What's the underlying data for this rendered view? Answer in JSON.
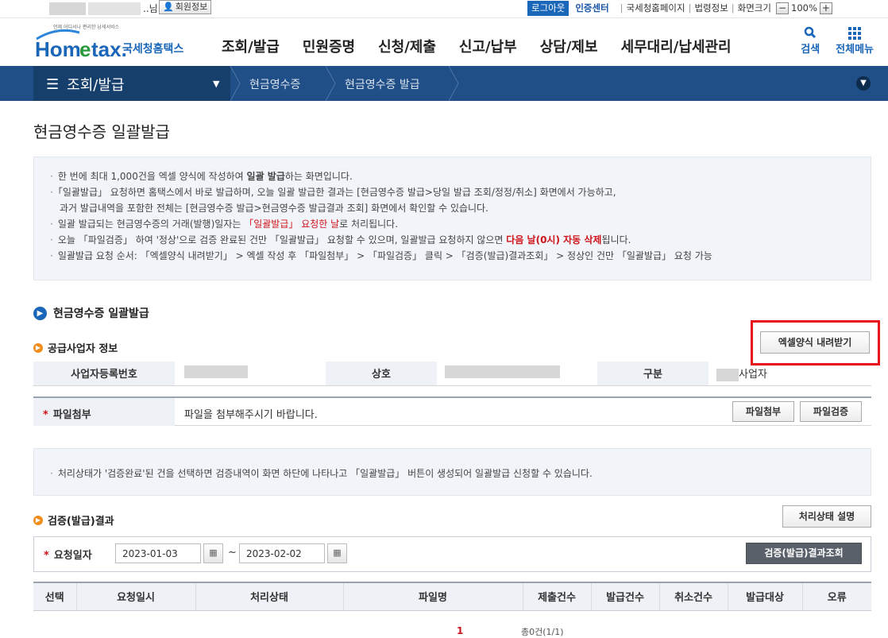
{
  "util": {
    "user_suffix": "..님",
    "profile": "회원정보",
    "logout": "로그아웃",
    "cert_center": "인증센터",
    "links": [
      "국세청홈페이지",
      "법령정보",
      "화면크기"
    ],
    "zoom": "100%"
  },
  "header": {
    "logo_small": "언제 어디서나 편리한 납세서비스",
    "logo_main": "Hometax",
    "logo_kor": "국세청홈택스",
    "gnb": [
      "조회/발급",
      "민원증명",
      "신청/제출",
      "신고/납부",
      "상담/제보",
      "세무대리/납세관리"
    ],
    "search": "검색",
    "all_menu": "전체메뉴"
  },
  "location": {
    "menu": "조회/발급",
    "crumb1": "현금영수증",
    "crumb2": "현금영수증 발급"
  },
  "page_title": "현금영수증 일괄발급",
  "info": {
    "l1a": "한 번에 최대 1,000건을 엑셀 양식에 작성하여 ",
    "l1b": "일괄 발급",
    "l1c": "하는 화면입니다.",
    "l2": "「일괄발급」 요청하면 홈택스에서 바로 발급하며, 오늘 일괄 발급한 결과는 [현금영수증 발급>당일 발급 조회/정정/취소] 화면에서 가능하고,",
    "l3": "과거 발급내역을 포함한 전체는 [현금영수증 발급>현금영수증 발급결과 조회] 화면에서 확인할 수 있습니다.",
    "l4a": "일괄 발급되는 현금영수증의 거래(발행)일자는 ",
    "l4b": "「일괄발급」 요청한 날",
    "l4c": "로 처리됩니다.",
    "l5a": "오늘 「파일검증」 하여 '정상'으로 검증 완료된 건만 「일괄발급」 요청할 수 있으며, 일괄발급 요청하지 않으면 ",
    "l5b": "다음 날(0시) 자동 삭제",
    "l5c": "됩니다.",
    "l6": "일괄발급 요청 순서: 「엑셀양식 내려받기」 > 엑셀 작성 후 「파일첨부」 > 「파일검증」 클릭 > 「검증(발급)결과조회」 > 정상인 건만 「일괄발급」 요청 가능"
  },
  "section_title": "현금영수증 일괄발급",
  "supplier": {
    "title": "공급사업자 정보",
    "download_btn": "엑셀양식 내려받기",
    "th_regno": "사업자등록번호",
    "th_name": "상호",
    "th_type": "구분",
    "type_suffix": "사업자"
  },
  "file": {
    "label": "파일첨부",
    "message": "파일을 첨부해주시기 바랍니다.",
    "attach_btn": "파일첨부",
    "verify_btn": "파일검증"
  },
  "note": "처리상태가 '검증완료'된 건을 선택하면 검증내역이 화면 하단에 나타나고 「일괄발급」 버튼이 생성되어 일괄발급 신청할 수 있습니다.",
  "result": {
    "title": "검증(발급)결과",
    "status_btn": "처리상태 설명",
    "date_label": "요청일자",
    "date_from": "2023-01-03",
    "date_tilde": "~",
    "date_to": "2023-02-02",
    "query_btn": "검증(발급)결과조회",
    "columns": [
      "선택",
      "요청일시",
      "처리상태",
      "파일명",
      "제출건수",
      "발급건수",
      "취소건수",
      "발급대상",
      "오류"
    ],
    "page": "1",
    "total": "총0건(1/1)"
  }
}
